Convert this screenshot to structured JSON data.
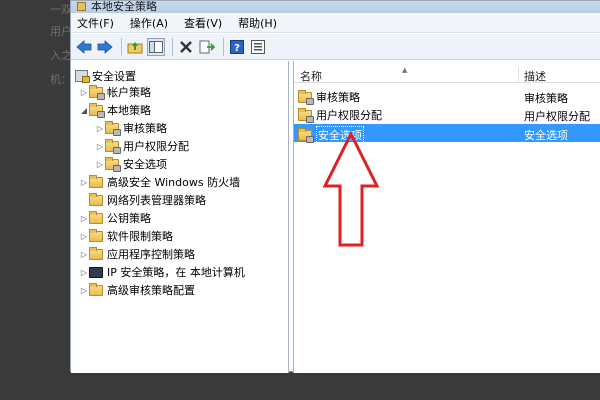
{
  "window": {
    "title": "本地安全策略"
  },
  "background_lines": [
    "一双",
    "用户",
    "入之",
    "机："
  ],
  "menu": [
    {
      "label": "文件(F)"
    },
    {
      "label": "操作(A)"
    },
    {
      "label": "查看(V)"
    },
    {
      "label": "帮助(H)"
    }
  ],
  "toolbar": {
    "icons": [
      "back-arrow-icon",
      "forward-arrow-icon",
      "up-folder-icon",
      "show-hide-tree-icon",
      "delete-icon",
      "export-icon",
      "help-icon",
      "properties-icon"
    ]
  },
  "tree": {
    "items": [
      {
        "label": "安全设置"
      },
      {
        "label": "帐户策略"
      },
      {
        "label": "本地策略"
      },
      {
        "label": "审核策略"
      },
      {
        "label": "用户权限分配"
      },
      {
        "label": "安全选项"
      },
      {
        "label": "高级安全 Windows 防火墙"
      },
      {
        "label": "网络列表管理器策略"
      },
      {
        "label": "公钥策略"
      },
      {
        "label": "软件限制策略"
      },
      {
        "label": "应用程序控制策略"
      },
      {
        "label": "IP 安全策略，在 本地计算机"
      },
      {
        "label": "高级审核策略配置"
      }
    ]
  },
  "list": {
    "columns": {
      "name": "名称",
      "desc": "描述"
    },
    "rows": [
      {
        "name": "审核策略",
        "desc": "审核策略"
      },
      {
        "name": "用户权限分配",
        "desc": "用户权限分配"
      },
      {
        "name": "安全选项",
        "desc": "安全选项"
      }
    ],
    "selected_index": 2
  },
  "colors": {
    "selection": "#3399ff",
    "annotation_arrow": "#e02020"
  }
}
